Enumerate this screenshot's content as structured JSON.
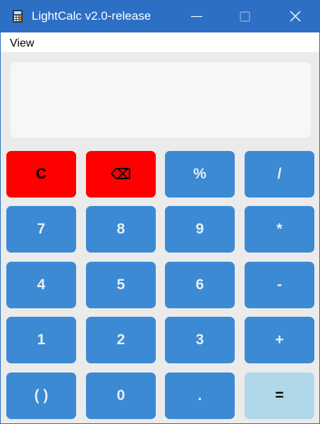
{
  "window": {
    "title": "LightCalc v2.0-release",
    "app_icon": "calculator-icon",
    "controls": {
      "minimize_icon": "minimize-icon",
      "maximize_icon": "maximize-icon",
      "close_icon": "close-icon"
    }
  },
  "menu": {
    "items": [
      {
        "label": "View"
      }
    ]
  },
  "display": {
    "value": ""
  },
  "colors": {
    "titlebar": "#2c6fc4",
    "key_default": "#3b8ad3",
    "key_danger": "#ff0000",
    "key_equals": "#b1d8e8",
    "background": "#ebebeb",
    "display_bg": "#f7f7f7"
  },
  "keys": {
    "clear": "C",
    "backspace": "⌫",
    "percent": "%",
    "divide": "/",
    "seven": "7",
    "eight": "8",
    "nine": "9",
    "multiply": "*",
    "four": "4",
    "five": "5",
    "six": "6",
    "minus": "-",
    "one": "1",
    "two": "2",
    "three": "3",
    "plus": "+",
    "parens": "( )",
    "zero": "0",
    "decimal": ".",
    "equals": "="
  }
}
